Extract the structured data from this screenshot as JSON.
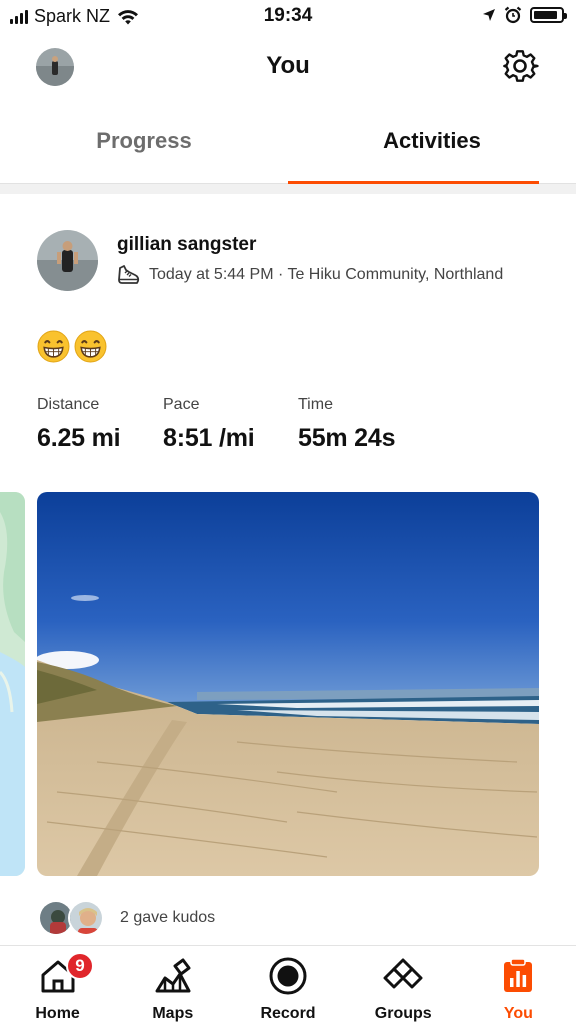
{
  "status_bar": {
    "carrier": "Spark NZ",
    "time": "19:34",
    "battery_level": 0.9
  },
  "header": {
    "title": "You",
    "settings_icon": "gear-icon"
  },
  "tabs": [
    {
      "label": "Progress",
      "active": false
    },
    {
      "label": "Activities",
      "active": true
    }
  ],
  "activity": {
    "athlete_name": "gillian sangster",
    "sport_icon": "shoe-icon",
    "meta": "Today at 5:44 PM · Te Hiku Community, Northland",
    "description": "😁😁",
    "stats": [
      {
        "label": "Distance",
        "value": "6.25 mi"
      },
      {
        "label": "Pace",
        "value": "8:51 /mi"
      },
      {
        "label": "Time",
        "value": "55m 24s"
      }
    ],
    "kudos_text": "2 gave kudos"
  },
  "bottom_nav": {
    "items": [
      {
        "label": "Home",
        "icon": "home-icon",
        "badge": "9"
      },
      {
        "label": "Maps",
        "icon": "map-icon"
      },
      {
        "label": "Record",
        "icon": "record-icon"
      },
      {
        "label": "Groups",
        "icon": "groups-icon"
      },
      {
        "label": "You",
        "icon": "you-icon",
        "active": true
      }
    ]
  },
  "colors": {
    "accent": "#fc4c02",
    "badge": "#e0262b",
    "sky": "#1f58b8",
    "sand": "#d7c29f"
  }
}
